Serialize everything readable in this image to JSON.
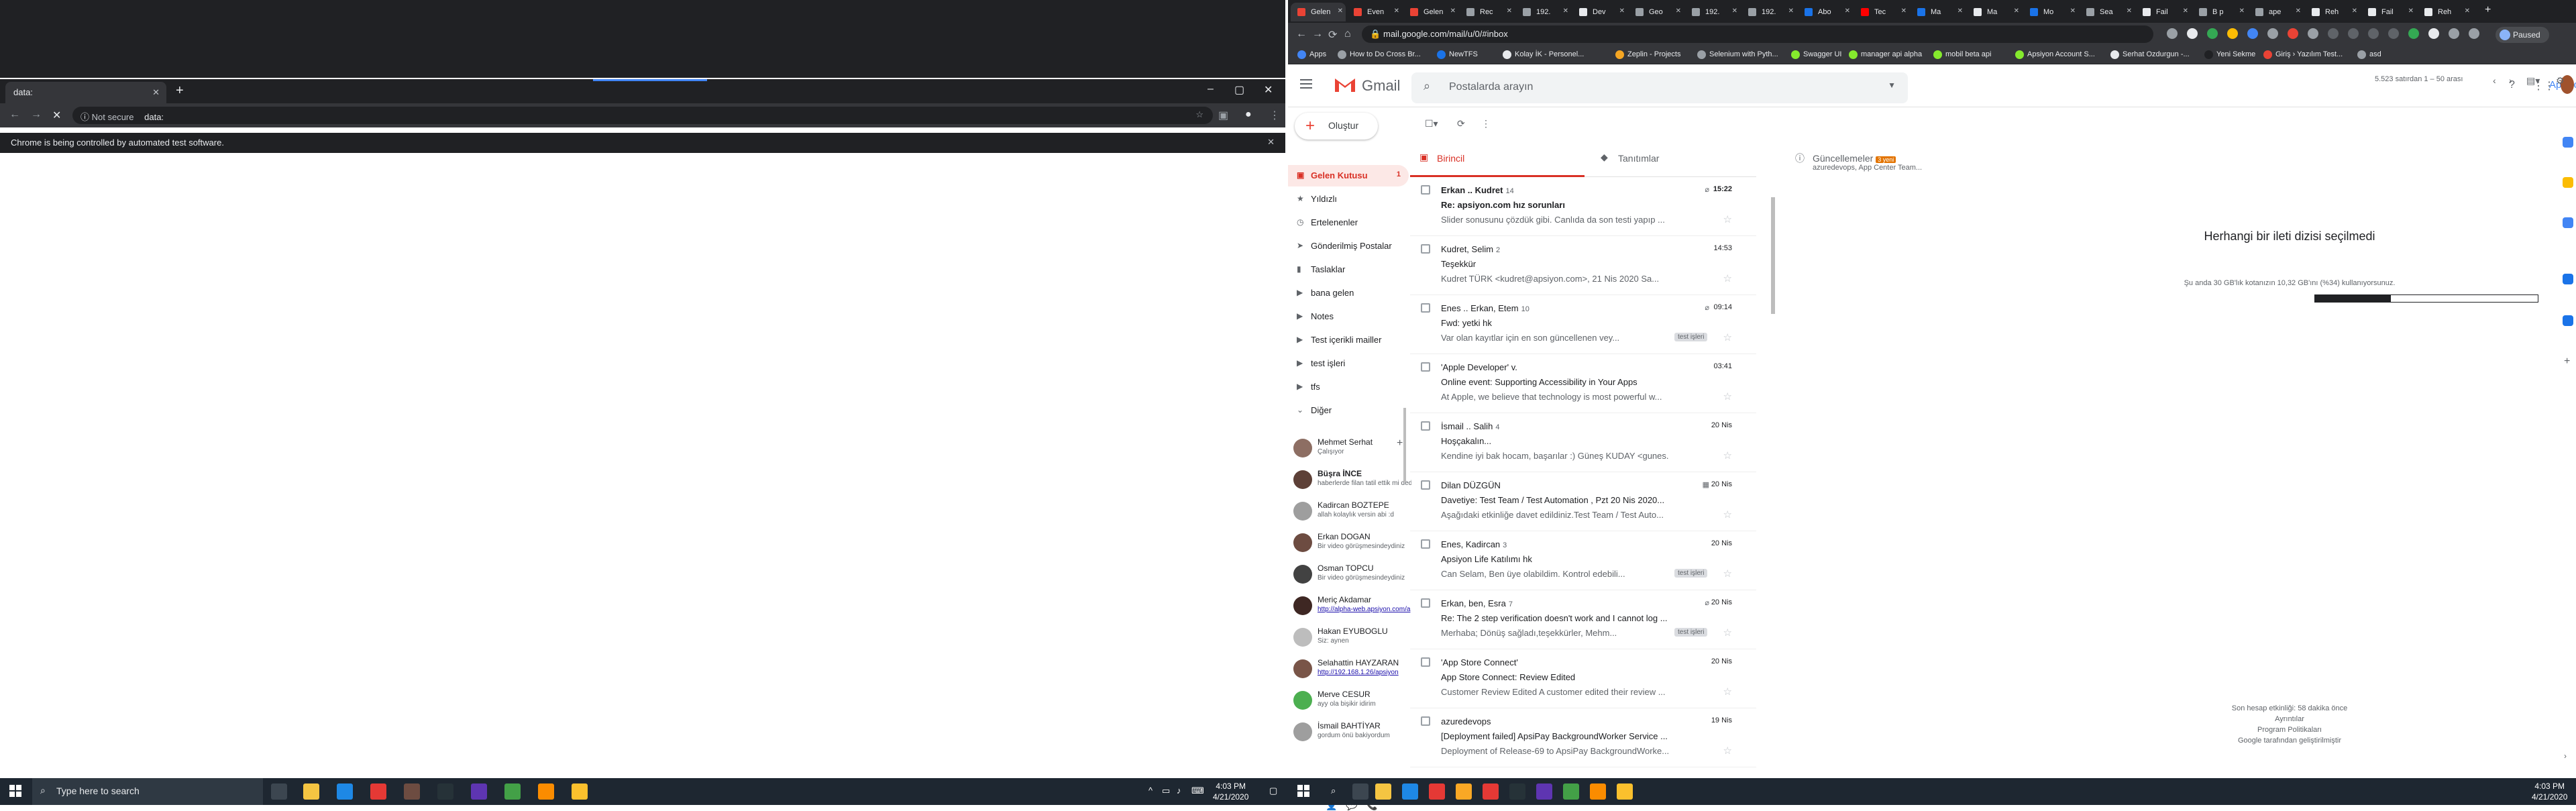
{
  "left_window": {
    "tab_title": "data:",
    "address_security": "Not secure",
    "address_url": "data:",
    "automation_notice": "Chrome is being controlled by automated test software."
  },
  "right_window": {
    "tabs": [
      {
        "title": "Gelen",
        "color": "#ea4335"
      },
      {
        "title": "Even",
        "color": "#ea4335"
      },
      {
        "title": "Gelen",
        "color": "#ea4335"
      },
      {
        "title": "Rec",
        "color": "#9aa0a6"
      },
      {
        "title": "192.",
        "color": "#9aa0a6"
      },
      {
        "title": "Dev",
        "color": "#e8eaed"
      },
      {
        "title": "Geo",
        "color": "#9aa0a6"
      },
      {
        "title": "192.",
        "color": "#9aa0a6"
      },
      {
        "title": "192.",
        "color": "#9aa0a6"
      },
      {
        "title": "Abo",
        "color": "#1a73e8"
      },
      {
        "title": "Tec",
        "color": "#ff0000"
      },
      {
        "title": "Ma",
        "color": "#1a73e8"
      },
      {
        "title": "Ma",
        "color": "#e8eaed"
      },
      {
        "title": "Mo",
        "color": "#1a73e8"
      },
      {
        "title": "Sea",
        "color": "#9aa0a6"
      },
      {
        "title": "Fail",
        "color": "#e8eaed"
      },
      {
        "title": "B p",
        "color": "#9aa0a6"
      },
      {
        "title": "ape",
        "color": "#9aa0a6"
      },
      {
        "title": "Reh",
        "color": "#e8eaed"
      },
      {
        "title": "Fail",
        "color": "#e8eaed"
      },
      {
        "title": "Reh",
        "color": "#e8eaed"
      }
    ],
    "url": "mail.google.com/mail/u/0/#inbox",
    "paused_label": "Paused",
    "bookmarks": [
      {
        "label": "Apps",
        "color": "#4285f4"
      },
      {
        "label": "How to Do Cross Br...",
        "color": "#9aa0a6"
      },
      {
        "label": "NewTFS",
        "color": "#1a73e8"
      },
      {
        "label": "Kolay İK - Personel...",
        "color": "#e8eaed"
      },
      {
        "label": "Zeplin - Projects",
        "color": "#f5a623"
      },
      {
        "label": "Selenium with Pyth...",
        "color": "#9aa0a6"
      },
      {
        "label": "Swagger UI",
        "color": "#85ea2d"
      },
      {
        "label": "manager api alpha",
        "color": "#85ea2d"
      },
      {
        "label": "mobil beta api",
        "color": "#85ea2d"
      },
      {
        "label": "Apsiyon Account S...",
        "color": "#85ea2d"
      },
      {
        "label": "Serhat Ozdurgun -...",
        "color": "#e8eaed"
      },
      {
        "label": "Yeni Sekme",
        "color": "#202124"
      },
      {
        "label": "Giriş › Yazılım Test...",
        "color": "#ea4335"
      },
      {
        "label": "asd",
        "color": "#9aa0a6"
      }
    ]
  },
  "gmail": {
    "brand": "Gmail",
    "search_placeholder": "Postalarda arayın",
    "org_label": "Apsiyon",
    "compose_label": "Oluştur",
    "nav": [
      {
        "label": "Gelen Kutusu",
        "icon": "inbox-icon",
        "count": "1",
        "selected": true
      },
      {
        "label": "Yıldızlı",
        "icon": "star-icon",
        "count": ""
      },
      {
        "label": "Ertelenenler",
        "icon": "clock-icon",
        "count": ""
      },
      {
        "label": "Gönderilmiş Postalar",
        "icon": "send-icon",
        "count": ""
      },
      {
        "label": "Taslaklar",
        "icon": "draft-icon",
        "count": ""
      },
      {
        "label": "bana gelen",
        "icon": "label-icon",
        "count": ""
      },
      {
        "label": "Notes",
        "icon": "label-icon",
        "count": ""
      },
      {
        "label": "Test içerikli mailler",
        "icon": "label-icon",
        "count": ""
      },
      {
        "label": "test işleri",
        "icon": "label-icon",
        "count": ""
      },
      {
        "label": "tfs",
        "icon": "label-icon",
        "count": ""
      },
      {
        "label": "Diğer",
        "icon": "chevron-down-icon",
        "count": ""
      }
    ],
    "hangouts": [
      {
        "name": "Mehmet Serhat",
        "sub": "Çalışıyor",
        "bold": false,
        "link": false,
        "color": "#8d6e63"
      },
      {
        "name": "Büşra İNCE",
        "sub": "haberlerde filan tatil ettik mi dedik",
        "bold": true,
        "link": false,
        "color": "#5d4037"
      },
      {
        "name": "Kadircan BOZTEPE",
        "sub": "allah kolaylık versin abi :d",
        "bold": false,
        "link": false,
        "color": "#9e9e9e"
      },
      {
        "name": "Erkan DOGAN",
        "sub": "Bir video görüşmesindeydiniz",
        "bold": false,
        "link": false,
        "color": "#6d4c41"
      },
      {
        "name": "Osman TOPCU",
        "sub": "Bir video görüşmesindeydiniz",
        "bold": false,
        "link": false,
        "color": "#424242"
      },
      {
        "name": "Meriç Akdamar",
        "sub": "http://alpha-web.apsiyon.com/a",
        "bold": false,
        "link": true,
        "color": "#3e2723"
      },
      {
        "name": "Hakan EYUBOGLU",
        "sub": "Siz: aynen",
        "bold": false,
        "link": false,
        "color": "#bdbdbd"
      },
      {
        "name": "Selahattin HAYZARAN",
        "sub": "http://192.168.1.26/apsiyon",
        "bold": false,
        "link": true,
        "color": "#795548"
      },
      {
        "name": "Merve CESUR",
        "sub": "ayy ola bişikir idirim",
        "bold": false,
        "link": false,
        "color": "#4caf50"
      },
      {
        "name": "İsmail BAHTİYAR",
        "sub": "gordum önü bakiyordum",
        "bold": false,
        "link": false,
        "color": "#9e9e9e"
      }
    ],
    "toolbar": {
      "range": "5.523 satırdan 1 – 50 arası"
    },
    "tabs": [
      {
        "label": "Birincil",
        "icon": "inbox-icon",
        "sub": "",
        "badge": ""
      },
      {
        "label": "Tanıtımlar",
        "icon": "tag-icon",
        "sub": "",
        "badge": ""
      },
      {
        "label": "Güncellemeler",
        "icon": "info-icon",
        "sub": "azuredevops, App Center Team...",
        "badge": "3 yeni"
      }
    ],
    "messages": [
      {
        "sender": "Erkan .. Kudret",
        "count": "14",
        "date": "15:22",
        "subject": "Re: apsiyon.com hız sorunları",
        "snippet": "Slider sonusunu çözdük gibi. Canlıda da son testi yapıp ...",
        "label": "",
        "unread": true,
        "icon": "attach-icon"
      },
      {
        "sender": "Kudret, Selim",
        "count": "2",
        "date": "14:53",
        "subject": "Teşekkür",
        "snippet": "Kudret TÜRK <kudret@apsiyon.com>, 21 Nis 2020 Sa...",
        "label": "",
        "unread": false,
        "icon": ""
      },
      {
        "sender": "Enes .. Erkan, Etem",
        "count": "10",
        "date": "09:14",
        "subject": "Fwd: yetki hk",
        "snippet": "Var olan kayıtlar için en son güncellenen vey...",
        "label": "test işleri",
        "unread": false,
        "icon": "attach-icon"
      },
      {
        "sender": "'Apple Developer' v.",
        "count": "",
        "date": "03:41",
        "subject": "Online event: Supporting Accessibility in Your Apps",
        "snippet": "At Apple, we believe that technology is most powerful w...",
        "label": "",
        "unread": false,
        "icon": ""
      },
      {
        "sender": "İsmail .. Salih",
        "count": "4",
        "date": "20 Nis",
        "subject": "Hoşçakalın...",
        "snippet": "Kendine iyi bak hocam, başarılar :) Güneş KUDAY <gunes...",
        "label": "",
        "unread": false,
        "icon": ""
      },
      {
        "sender": "Dilan DÜZGÜN",
        "count": "",
        "date": "20 Nis",
        "subject": "Davetiye: Test Team / Test Automation , Pzt 20 Nis 2020...",
        "snippet": "Aşağıdaki etkinliğe davet edildiniz.Test Team / Test Auto...",
        "label": "",
        "unread": false,
        "icon": "calendar-icon"
      },
      {
        "sender": "Enes, Kadircan",
        "count": "3",
        "date": "20 Nis",
        "subject": "Apsiyon Life Katılımı hk",
        "snippet": "Can Selam, Ben üye olabildim. Kontrol edebili...",
        "label": "test işleri",
        "unread": false,
        "icon": ""
      },
      {
        "sender": "Erkan, ben, Esra",
        "count": "7",
        "date": "20 Nis",
        "subject": "Re: The 2 step verification doesn't work and I cannot log ...",
        "snippet": "Merhaba; Dönüş sağladı,teşekkürler, Mehm...",
        "label": "test işleri",
        "unread": false,
        "icon": "attach-icon"
      },
      {
        "sender": "'App Store Connect'",
        "count": "",
        "date": "20 Nis",
        "subject": "App Store Connect: Review Edited",
        "snippet": "Customer Review Edited A customer edited their review ...",
        "label": "",
        "unread": false,
        "icon": ""
      },
      {
        "sender": "azuredevops",
        "count": "",
        "date": "19 Nis",
        "subject": "[Deployment failed] ApsiPay BackgroundWorker Service ...",
        "snippet": "Deployment of Release-69 to ApsiPay BackgroundWorke...",
        "label": "",
        "unread": false,
        "icon": ""
      }
    ],
    "reading": {
      "no_selection": "Herhangi bir ileti dizisi seçilmedi",
      "quota": "Şu anda 30 GB'lık kotanızın 10,32 GB'ını (%34) kullanıyorsunuz.",
      "quota_fraction": 0.34,
      "activity": "Son hesap etkinliği: 58 dakika önce",
      "details": "Ayrıntılar",
      "policies": "Program Politikaları",
      "powered": "Google tarafından geliştirilmiştir"
    }
  },
  "taskbar": {
    "search_placeholder": "Type here to search",
    "left_time": "4:03 PM",
    "left_date": "4/21/2020",
    "right_time": "4:03 PM",
    "right_date": "4/21/2020"
  }
}
